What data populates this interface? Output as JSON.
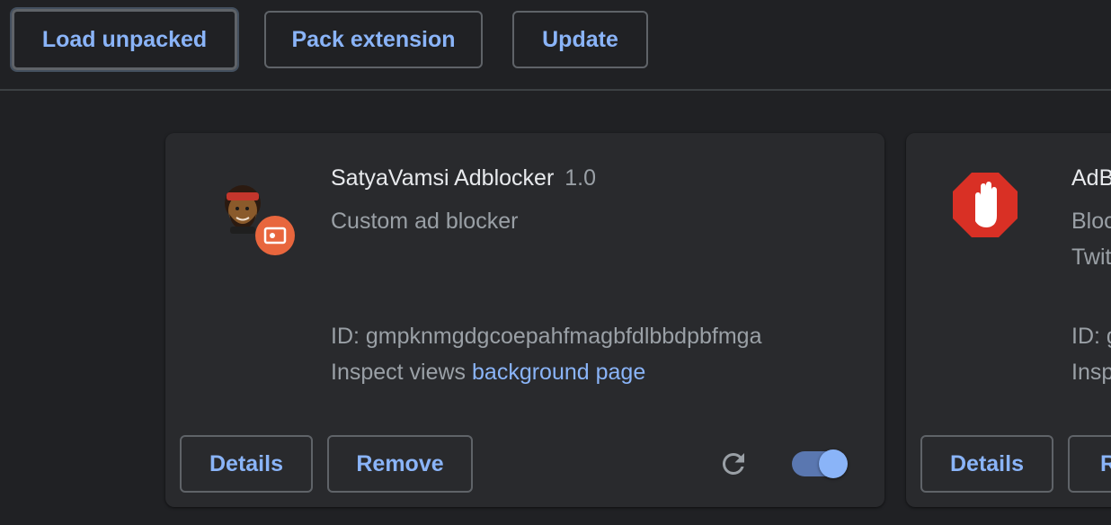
{
  "toolbar": {
    "load_unpacked": "Load unpacked",
    "pack_extension": "Pack extension",
    "update": "Update"
  },
  "extensions": [
    {
      "name": "SatyaVamsi Adblocker",
      "version": "1.0",
      "description": "Custom ad blocker",
      "id_label": "ID: gmpknmgdgcoepahfmagbfdlbbdpbfmga",
      "inspect_label": "Inspect views",
      "inspect_link": "background page",
      "details_label": "Details",
      "remove_label": "Remove",
      "enabled": true
    },
    {
      "name": "AdB",
      "description_line1": "Bloc",
      "description_line2": "Twit",
      "id_label": "ID: g",
      "inspect_label": "Insp",
      "details_label": "Details",
      "remove_label": "R"
    }
  ],
  "colors": {
    "background": "#202124",
    "card": "#292a2d",
    "accent": "#8ab4f8",
    "border": "#5f6368",
    "stop_sign": "#d93025"
  }
}
